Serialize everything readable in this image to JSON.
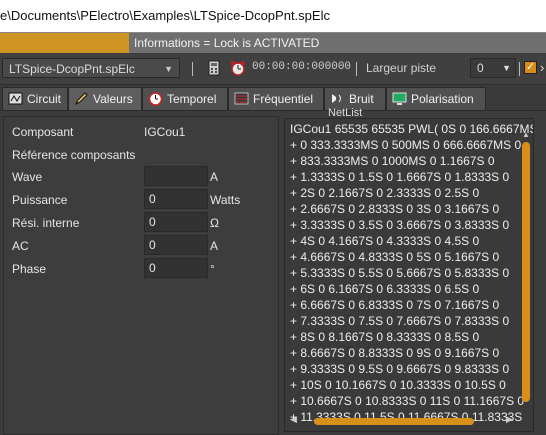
{
  "title": "e\\Documents\\PElectro\\Examples\\LTSpice-DcopPnt.spElc",
  "info": "Informations = Lock is ACTIVATED",
  "toolbar": {
    "file_combo": "LTSpice-DcopPnt.spElc",
    "time": "00:00:00:000000",
    "track_width_label": "Largeur piste",
    "track_width_value": "0",
    "checkbox_checked": true
  },
  "tabs": [
    {
      "label": "Circuit",
      "icon": "circuit-icon"
    },
    {
      "label": "Valeurs",
      "icon": "pencil-icon",
      "active": true
    },
    {
      "label": "Temporel",
      "icon": "clock-icon"
    },
    {
      "label": "Fréquentiel",
      "icon": "frequency-icon"
    },
    {
      "label": "Bruit",
      "icon": "noise-icon"
    },
    {
      "label": "Polarisation",
      "icon": "monitor-icon"
    }
  ],
  "component": {
    "label": "Composant",
    "value": "IGCou1",
    "ref_label": "Référence composants",
    "fields": [
      {
        "label": "Wave",
        "value": "",
        "unit": "A"
      },
      {
        "label": "Puissance",
        "value": "0",
        "unit": "Watts"
      },
      {
        "label": "Rési. interne",
        "value": "0",
        "unit": "Ω"
      },
      {
        "label": "AC",
        "value": "0",
        "unit": "A"
      },
      {
        "label": "Phase",
        "value": "0",
        "unit": "°"
      }
    ]
  },
  "netlist": {
    "label": "NetList",
    "lines": [
      "IGCou1 65535 65535 PWL( 0S 0 166.6667MS",
      "+ 0 333.3333MS 0 500MS 0 666.6667MS 0",
      "+ 833.3333MS 0 1000MS 0 1.1667S 0",
      "+ 1.3333S 0 1.5S 0 1.6667S 0 1.8333S 0",
      "+ 2S 0 2.1667S 0 2.3333S 0 2.5S 0",
      "+ 2.6667S 0 2.8333S 0 3S 0 3.1667S 0",
      "+ 3.3333S 0 3.5S 0 3.6667S 0 3.8333S 0",
      "+ 4S 0 4.1667S 0 4.3333S 0 4.5S 0",
      "+ 4.6667S 0 4.8333S 0 5S 0 5.1667S 0",
      "+ 5.3333S 0 5.5S 0 5.6667S 0 5.8333S 0",
      "+ 6S 0 6.1667S 0 6.3333S 0 6.5S 0",
      "+ 6.6667S 0 6.8333S 0 7S 0 7.1667S 0",
      "+ 7.3333S 0 7.5S 0 7.6667S 0 7.8333S 0",
      "+ 8S 0 8.1667S 0 8.3333S 0 8.5S 0",
      "+ 8.6667S 0 8.8333S 0 9S 0 9.1667S 0",
      "+ 9.3333S 0 9.5S 0 9.6667S 0 9.8333S 0",
      "+ 10S 0 10.1667S 0 10.3333S 0 10.5S 0",
      "+ 10.6667S 0 10.8333S 0 11S 0 11.1667S 0",
      "+ 11.3333S 0 11.5S 0 11.6667S 0 11.8333S"
    ]
  },
  "colors": {
    "accent": "#d99018",
    "background": "#3c3c3c"
  }
}
